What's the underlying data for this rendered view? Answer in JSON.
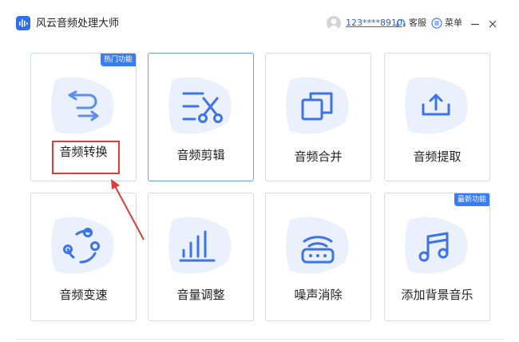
{
  "app": {
    "title": "风云音频处理大师",
    "user_id": "123****8910",
    "service_label": "客服",
    "menu_label": "菜单"
  },
  "colors": {
    "accent": "#3b7cf5",
    "icon_blue": "#3d73e6",
    "blob": "#eaf1fd",
    "highlight": "#e03a3a"
  },
  "cards": [
    {
      "label": "音频转换",
      "icon": "convert-icon",
      "badge": "热门功能"
    },
    {
      "label": "音频剪辑",
      "icon": "scissors-icon",
      "active": true
    },
    {
      "label": "音频合并",
      "icon": "merge-icon"
    },
    {
      "label": "音频提取",
      "icon": "extract-icon"
    },
    {
      "label": "音频变速",
      "icon": "speed-icon"
    },
    {
      "label": "音量调整",
      "icon": "volume-bars-icon"
    },
    {
      "label": "噪声消除",
      "icon": "noise-icon"
    },
    {
      "label": "添加背景音乐",
      "icon": "music-note-icon",
      "badge": "最新功能"
    }
  ]
}
